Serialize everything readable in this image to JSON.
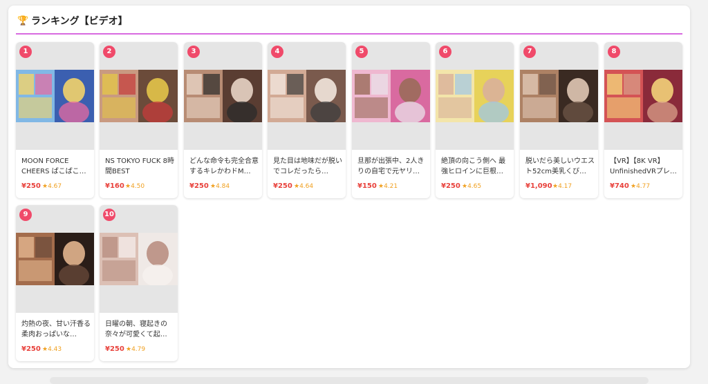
{
  "section": {
    "trophy_icon": "trophy-icon",
    "title": "ランキング【ビデオ】",
    "accent_color": "#d86ae0",
    "rank_badge_color": "#f04a6a",
    "price_color": "#e8413b",
    "rating_color": "#f0a020"
  },
  "items": [
    {
      "rank": "1",
      "title": "MOON FORCE CHEERS ぱこぱこし…",
      "price": "¥250",
      "rating": "★4.67",
      "palette": [
        "#3b5fb0",
        "#8ec8ef",
        "#f3d36a",
        "#e86aa0"
      ]
    },
    {
      "rank": "2",
      "title": "NS TOKYO FUCK 8時間BEST",
      "price": "¥160",
      "rating": "★4.50",
      "palette": [
        "#6b4b3a",
        "#d9a88e",
        "#e3c44a",
        "#c43b3b"
      ]
    },
    {
      "rank": "3",
      "title": "どんな命令も完全合意するキレかわドM…",
      "price": "¥250",
      "rating": "★4.84",
      "palette": [
        "#5a3d32",
        "#c99a80",
        "#e7d3c4",
        "#2b2b2b"
      ]
    },
    {
      "rank": "4",
      "title": "見た目は地味だが脱いでコレだったら…",
      "price": "¥250",
      "rating": "★4.64",
      "palette": [
        "#7a5a4d",
        "#e2b8a2",
        "#f2e6dd",
        "#3d3d3d"
      ]
    },
    {
      "rank": "5",
      "title": "旦那が出張中、2人きりの自宅で元ヤリ…",
      "price": "¥150",
      "rating": "★4.21",
      "palette": [
        "#d96aa0",
        "#f2c6d8",
        "#9a6b5a",
        "#e9e2ea"
      ]
    },
    {
      "rank": "6",
      "title": "絶頂の向こう側へ 最強ヒロインに巨根…",
      "price": "¥250",
      "rating": "★4.65",
      "palette": [
        "#e7d25a",
        "#f5e9b8",
        "#d9b09a",
        "#9fc7e6"
      ]
    },
    {
      "rank": "7",
      "title": "脱いだら美しいウエスト52cm美乳くび…",
      "price": "¥1,090",
      "rating": "★4.17",
      "palette": [
        "#3a2a22",
        "#c29070",
        "#e0c7b4",
        "#6d5547"
      ]
    },
    {
      "rank": "8",
      "title": "【VR】【8K VR】UnfinishedVRプレ…",
      "price": "¥740",
      "rating": "★4.77",
      "palette": [
        "#8a2a3a",
        "#e05a5a",
        "#f2d27a",
        "#d9a08a"
      ]
    },
    {
      "rank": "9",
      "title": "灼熱の夜、甘い汗香る柔肉おっぱいな…",
      "price": "¥250",
      "rating": "★4.43",
      "palette": [
        "#2a1d18",
        "#b97a56",
        "#e2b58e",
        "#6a4a3a"
      ]
    },
    {
      "rank": "10",
      "title": "日曜の朝、寝起きの奈々が可愛くて起…",
      "price": "¥250",
      "rating": "★4.79",
      "palette": [
        "#efe9e6",
        "#d8b9ac",
        "#b98f82",
        "#f7f1ef"
      ]
    }
  ]
}
